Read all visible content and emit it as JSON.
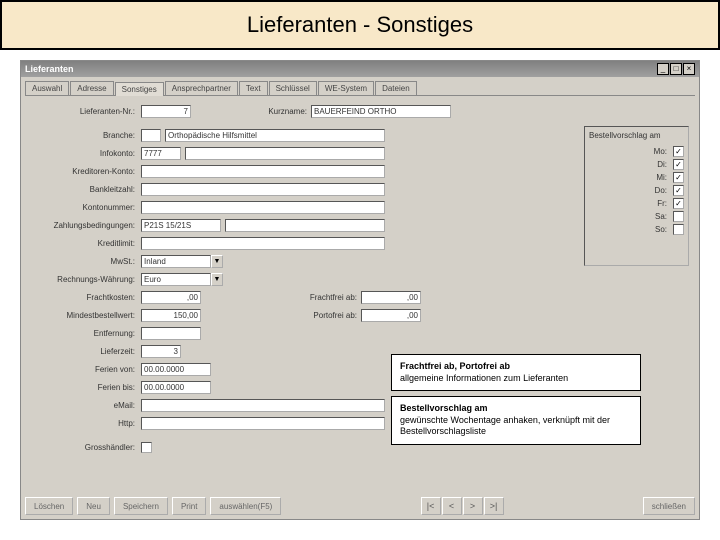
{
  "banner": {
    "title": "Lieferanten - Sonstiges"
  },
  "window": {
    "title": "Lieferanten",
    "tabs": [
      "Auswahl",
      "Adresse",
      "Sonstiges",
      "Ansprechpartner",
      "Text",
      "Schlüssel",
      "WE-System",
      "Dateien"
    ],
    "activeTab": 2
  },
  "fields": {
    "lieferantenNr": {
      "label": "Lieferanten-Nr.:",
      "value": "7"
    },
    "kurzname": {
      "label": "Kurzname:",
      "value": "BAUERFEIND ORTHO"
    },
    "branche": {
      "label": "Branche:",
      "code": "",
      "text": "Orthopädische Hilfsmittel"
    },
    "infokonto": {
      "label": "Infokonto:",
      "value": "7777"
    },
    "kreditorenKonto": {
      "label": "Kreditoren-Konto:",
      "value": ""
    },
    "bankleitzahl": {
      "label": "Bankleitzahl:",
      "value": ""
    },
    "kontonummer": {
      "label": "Kontonummer:",
      "value": ""
    },
    "zahlungsbedingungen": {
      "label": "Zahlungsbedingungen:",
      "value": "P21S 15/21S"
    },
    "kreditlimit": {
      "label": "Kreditlimit:",
      "value": ""
    },
    "mwst": {
      "label": "MwSt.:",
      "value": "Inland"
    },
    "waehrung": {
      "label": "Rechnungs-Währung:",
      "value": "Euro"
    },
    "frachtkosten": {
      "label": "Frachtkosten:",
      "value": ",00"
    },
    "frachtfreiAb": {
      "label": "Frachtfrei ab:",
      "value": ",00"
    },
    "mindestbestellwert": {
      "label": "Mindestbestellwert:",
      "value": "150,00"
    },
    "portofreiAb": {
      "label": "Portofrei ab:",
      "value": ",00"
    },
    "entfernung": {
      "label": "Entfernung:",
      "value": ""
    },
    "lieferzeit": {
      "label": "Lieferzeit:",
      "value": "3"
    },
    "ferienVon": {
      "label": "Ferien von:",
      "value": "00.00.0000"
    },
    "ferienBis": {
      "label": "Ferien bis:",
      "value": "00.00.0000"
    },
    "email": {
      "label": "eMail:",
      "value": ""
    },
    "http": {
      "label": "Http:",
      "value": ""
    },
    "grosshaendler": {
      "label": "Grosshändler:",
      "checked": false
    }
  },
  "rightPanel": {
    "header": "Bestellvorschlag am",
    "days": [
      {
        "label": "Mo:",
        "checked": true
      },
      {
        "label": "Di:",
        "checked": true
      },
      {
        "label": "Mi:",
        "checked": true
      },
      {
        "label": "Do:",
        "checked": true
      },
      {
        "label": "Fr:",
        "checked": true
      },
      {
        "label": "Sa:",
        "checked": false
      },
      {
        "label": "So:",
        "checked": false
      }
    ]
  },
  "callouts": {
    "c1": {
      "title": "Frachtfrei ab, Portofrei ab",
      "text": "allgemeine Informationen zum Lieferanten"
    },
    "c2": {
      "title": "Bestellvorschlag am",
      "text": "gewünschte Wochentage anhaken, verknüpft mit der Bestellvorschlagsliste"
    }
  },
  "buttons": {
    "loeschen": "Löschen",
    "neu": "Neu",
    "speichern": "Speichern",
    "print": "Print",
    "auswaehlen": "auswählen(F5)",
    "schliessen": "schließen",
    "nav": [
      "|<",
      "<",
      ">",
      ">|"
    ]
  }
}
